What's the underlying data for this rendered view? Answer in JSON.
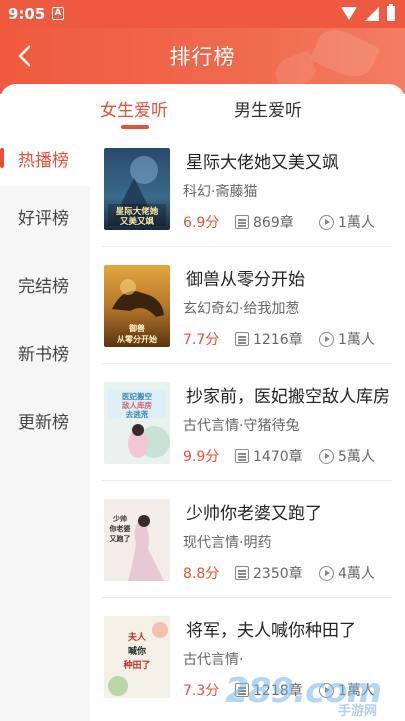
{
  "status_bar": {
    "time": "9:05",
    "notification_icon": "a-icon"
  },
  "header": {
    "title": "排行榜",
    "back_icon": "back-arrow-icon"
  },
  "tabs": [
    {
      "label": "女生爱听",
      "active": true
    },
    {
      "label": "男生爱听",
      "active": false
    }
  ],
  "sidebar": {
    "items": [
      {
        "label": "热播榜",
        "active": true
      },
      {
        "label": "好评榜",
        "active": false
      },
      {
        "label": "完结榜",
        "active": false
      },
      {
        "label": "新书榜",
        "active": false
      },
      {
        "label": "更新榜",
        "active": false
      }
    ]
  },
  "books": [
    {
      "title": "星际大佬她又美又飒",
      "meta": "科幻·斋藤猫",
      "score": "6.9",
      "score_unit": "分",
      "chapters": "869章",
      "listens": "1萬人",
      "cover_text": "星际大佬她又美又飒"
    },
    {
      "title": "御兽从零分开始",
      "meta": "玄幻奇幻·给我加葱",
      "score": "7.7",
      "score_unit": "分",
      "chapters": "1216章",
      "listens": "1萬人",
      "cover_text": "御兽从零分开始"
    },
    {
      "title": "抄家前，医妃搬空敌人库房",
      "meta": "古代言情·守猪待兔",
      "score": "9.9",
      "score_unit": "分",
      "chapters": "1470章",
      "listens": "5萬人",
      "cover_text": "医妃搬空敌人库房去逃荒"
    },
    {
      "title": "少帅你老婆又跑了",
      "meta": "现代言情·明药",
      "score": "8.8",
      "score_unit": "分",
      "chapters": "2350章",
      "listens": "4萬人",
      "cover_text": "少帅你老婆又跑了"
    },
    {
      "title": "将军，夫人喊你种田了",
      "meta": "古代言情·",
      "score": "7.3",
      "score_unit": "分",
      "chapters": "1218章",
      "listens": "1萬人",
      "cover_text": "夫人喊你种田了"
    }
  ],
  "watermark": {
    "main": "289.com",
    "sub": "手游网"
  },
  "colors": {
    "accent": "#e8503a",
    "header": "#ef5a3e"
  }
}
